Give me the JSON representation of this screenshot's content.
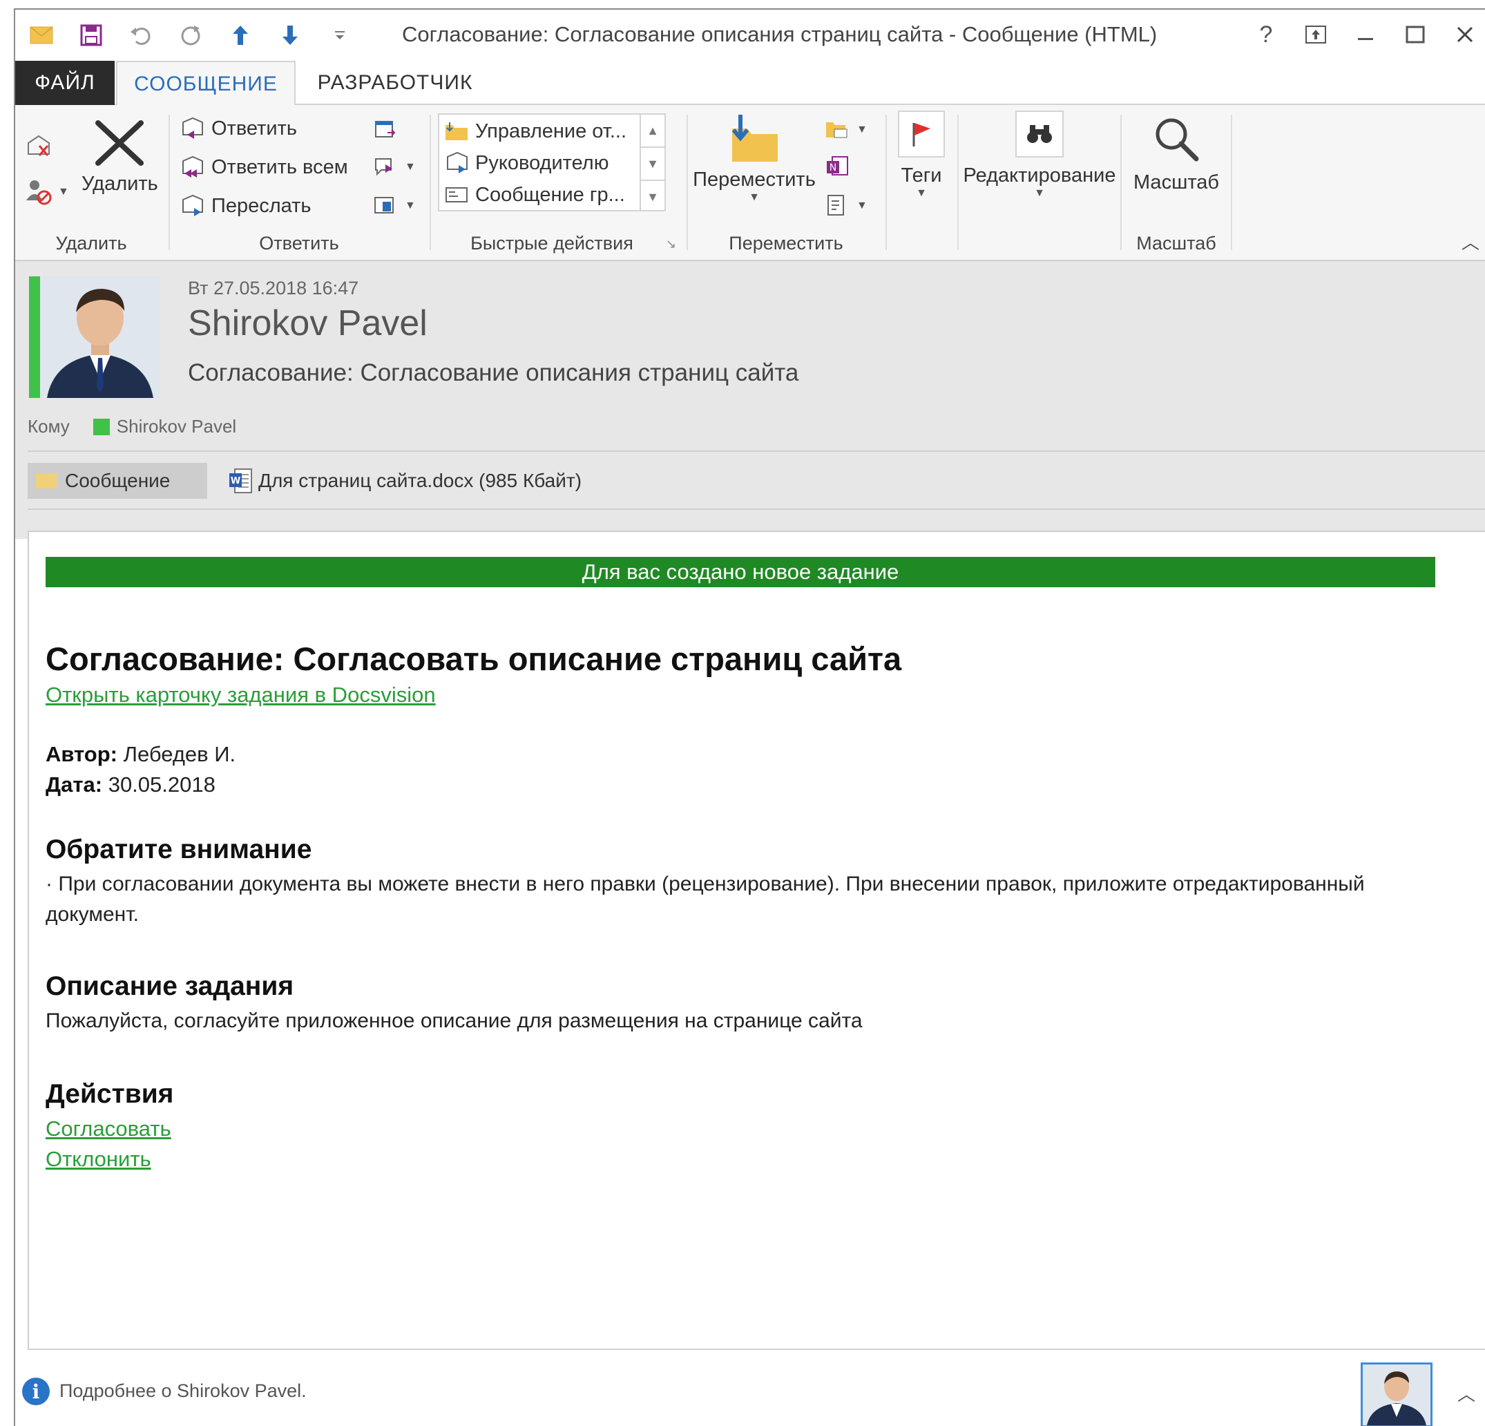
{
  "window": {
    "title": "Согласование: Согласование описания страниц сайта - Сообщение (HTML)"
  },
  "tabs": [
    {
      "label": "ФАЙЛ"
    },
    {
      "label": "СООБЩЕНИЕ"
    },
    {
      "label": "РАЗРАБОТЧИК"
    }
  ],
  "ribbon": {
    "delete_group": {
      "delete_label": "Удалить",
      "group_label": "Удалить"
    },
    "respond_group": {
      "reply": "Ответить",
      "reply_all": "Ответить всем",
      "forward": "Переслать",
      "group_label": "Ответить"
    },
    "quick_steps": {
      "items": [
        "Управление от...",
        "Руководителю",
        "Сообщение гр..."
      ],
      "group_label": "Быстрые действия"
    },
    "move_group": {
      "move_label": "Переместить",
      "group_label": "Переместить"
    },
    "tags": {
      "label": "Теги"
    },
    "editing": {
      "label": "Редактирование"
    },
    "zoom_group": {
      "zoom_label": "Масштаб",
      "group_label": "Масштаб"
    }
  },
  "message": {
    "date": "Вт 27.05.2018 16:47",
    "sender": "Shirokov Pavel",
    "subject": "Согласование: Согласование описания страниц сайта",
    "to_label": "Кому",
    "to_name": "Shirokov Pavel",
    "attachments": {
      "message_tab": "Сообщение",
      "file": "Для страниц сайта.docx (985 Кбайт)"
    }
  },
  "body": {
    "banner": "Для вас создано новое задание",
    "heading": "Согласование: Согласовать описание страниц сайта",
    "open_link": "Открыть карточку задания в Docsvision",
    "author_label": "Автор:",
    "author_value": "Лебедев И.",
    "date_label": "Дата:",
    "date_value": "30.05.2018",
    "attention_heading": "Обратите внимание",
    "attention_text": "· При согласовании документа вы можете внести в него правки (рецензирование). При внесении правок, приложите отредактированный документ.",
    "desc_heading": "Описание задания",
    "desc_text": "Пожалуйста, согласуйте приложенное описание для размещения на странице сайта",
    "actions_heading": "Действия",
    "action_approve": "Согласовать",
    "action_reject": "Отклонить"
  },
  "footer": {
    "info_text": "Подробнее о Shirokov Pavel."
  },
  "colors": {
    "banner_green": "#1f8a24",
    "link_green": "#2a9d3a",
    "presence_green": "#3fc14a",
    "tab_blue": "#2a6eba"
  }
}
